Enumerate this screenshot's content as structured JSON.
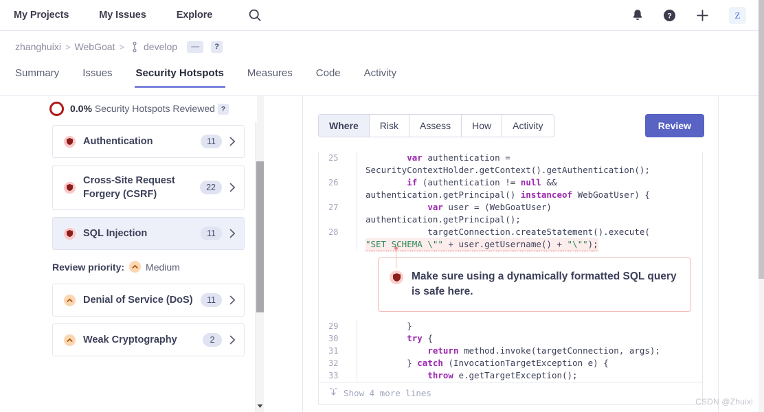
{
  "globalnav": {
    "items": [
      {
        "label": "My Projects"
      },
      {
        "label": "My Issues"
      },
      {
        "label": "Explore"
      }
    ],
    "search_icon": "search-icon",
    "bell_icon": "bell-icon",
    "help_icon": "help-icon",
    "plus_icon": "plus-icon",
    "avatar_initial": "Z"
  },
  "breadcrumb": {
    "org": "zhanghuixi",
    "sep": ">",
    "project": "WebGoat",
    "branch": "develop",
    "branch_icon": "branch-icon",
    "quality_badge": "—",
    "help_badge": "?"
  },
  "project_tabs": [
    {
      "label": "Summary",
      "active": false
    },
    {
      "label": "Issues",
      "active": false
    },
    {
      "label": "Security Hotspots",
      "active": true
    },
    {
      "label": "Measures",
      "active": false
    },
    {
      "label": "Code",
      "active": false
    },
    {
      "label": "Activity",
      "active": false
    }
  ],
  "sidebar": {
    "reviewed_percent": "0.0%",
    "reviewed_label": "Security Hotspots Reviewed",
    "reviewed_help": "?",
    "categories_high": [
      {
        "label": "Authentication",
        "count": "11",
        "severity": "high"
      },
      {
        "label": "Cross-Site Request Forgery (CSRF)",
        "count": "22",
        "severity": "high"
      },
      {
        "label": "SQL Injection",
        "count": "11",
        "severity": "high",
        "selected": true
      }
    ],
    "priority_title": "Review priority:",
    "priority_value": "Medium",
    "categories_medium": [
      {
        "label": "Denial of Service (DoS)",
        "count": "11",
        "severity": "medium"
      },
      {
        "label": "Weak Cryptography",
        "count": "2",
        "severity": "medium"
      }
    ]
  },
  "main": {
    "tabs": [
      {
        "label": "Where",
        "active": true
      },
      {
        "label": "Risk",
        "active": false
      },
      {
        "label": "Assess",
        "active": false
      },
      {
        "label": "How",
        "active": false
      },
      {
        "label": "Activity",
        "active": false
      }
    ],
    "review_button": "Review",
    "code_lines": [
      {
        "number": "25",
        "text_a": "        ",
        "kw1": "var",
        "text_b": " authentication = SecurityContextHolder.getContext().getAuthentication();"
      },
      {
        "number": "26",
        "text_a": "        ",
        "kw1": "if",
        "text_b": " (authentication != ",
        "kw2": "null",
        "text_c": " && authentication.getPrincipal() ",
        "kw3": "instanceof",
        "text_d": " WebGoatUser) {"
      },
      {
        "number": "27",
        "text_a": "            ",
        "kw1": "var",
        "text_b": " user = (WebGoatUser) authentication.getPrincipal();"
      },
      {
        "number": "28",
        "text_a": "            targetConnection.createStatement().execute(",
        "str1": "\"SET SCHEMA \\\"\"",
        "text_b": " + user.getUsername() + ",
        "str2": "\"\\\"\"",
        "text_c": ");"
      },
      {
        "number": "29",
        "text_a": "        }"
      },
      {
        "number": "30",
        "text_a": "        ",
        "kw1": "try",
        "text_b": " {"
      },
      {
        "number": "31",
        "text_a": "            ",
        "kw1": "return",
        "text_b": " method.invoke(targetConnection, args);"
      },
      {
        "number": "32",
        "text_a": "        } ",
        "kw1": "catch",
        "text_b": " (InvocationTargetException e) {"
      },
      {
        "number": "33",
        "text_a": "            ",
        "kw1": "throw",
        "text_b": " e.getTargetException();"
      }
    ],
    "alert": {
      "icon": "shield-icon",
      "message": "Make sure using a dynamically formatted SQL query is safe here."
    },
    "show_more": "Show 4 more lines",
    "show_more_icon": "expand-down-icon"
  },
  "watermark": "CSDN @Zhuixi",
  "colors": {
    "accent": "#5863c4",
    "tab_underline": "#7b84dd",
    "high_severity": "#fbc6c6",
    "medium_severity": "#fbd6b0",
    "donut_red": "#b01818",
    "alert_border": "#f3b9b6",
    "highlight_bg": "#fdecec"
  }
}
